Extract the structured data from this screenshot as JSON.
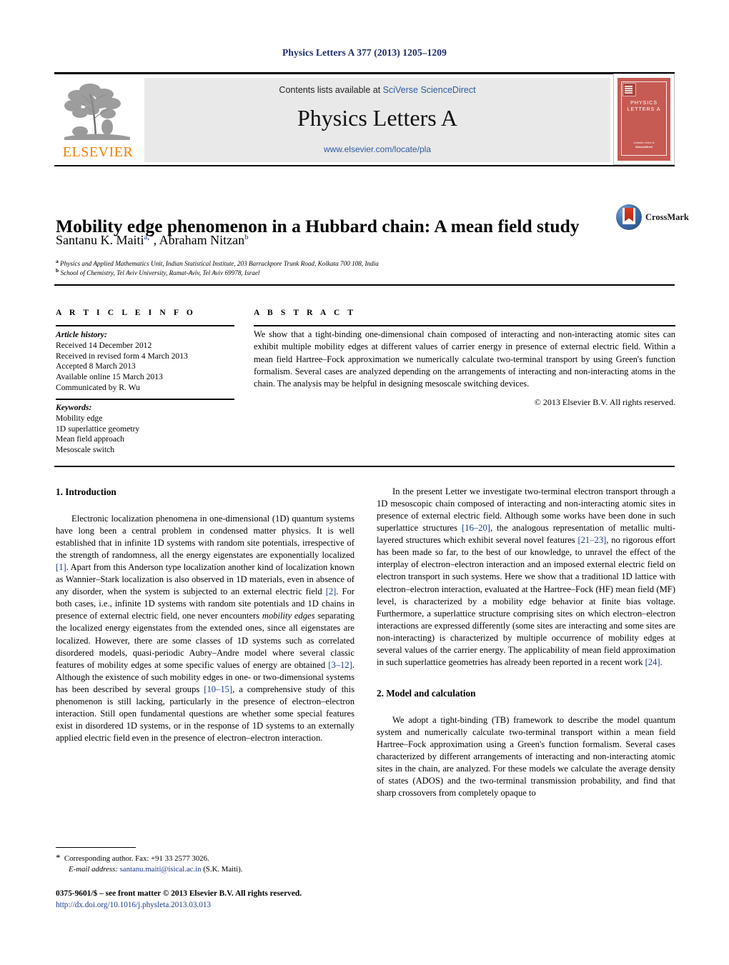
{
  "running_head": "Physics Letters A 377 (2013) 1205–1209",
  "masthead": {
    "contents_prefix": "Contents lists available at ",
    "contents_link": "SciVerse ScienceDirect",
    "journal_title": "Physics Letters A",
    "journal_url": "www.elsevier.com/locate/pla",
    "publisher_name": "ELSEVIER",
    "publisher_color": "#f08000",
    "cover_title": "PHYSICS LETTERS A",
    "cover_color": "#c65b53",
    "cover_footer_line1": "Available online at",
    "cover_footer_line2": "ScienceDirect"
  },
  "article": {
    "title": "Mobility edge phenomenon in a Hubbard chain: A mean field study",
    "authors_part1": "Santanu K. Maiti",
    "authors_sup1": "a",
    "authors_star": ",*",
    "authors_part2": ", Abraham Nitzan",
    "authors_sup2": "b",
    "affiliation_a_sup": "a",
    "affiliation_a": "Physics and Applied Mathematics Unit, Indian Statistical Institute, 203 Barrackpore Trunk Road, Kolkata 700 108, India",
    "affiliation_b_sup": "b",
    "affiliation_b": "School of Chemistry, Tel Aviv University, Ramat-Aviv, Tel Aviv 69978, Israel",
    "crossmark_label": "CrossMark"
  },
  "info": {
    "heading": "A R T I C L E   I N F O",
    "history_label": "Article history:",
    "history": [
      "Received 14 December 2012",
      "Received in revised form 4 March 2013",
      "Accepted 8 March 2013",
      "Available online 15 March 2013",
      "Communicated by R. Wu"
    ],
    "keywords_label": "Keywords:",
    "keywords": [
      "Mobility edge",
      "1D superlattice geometry",
      "Mean field approach",
      "Mesoscale switch"
    ]
  },
  "abstract": {
    "heading": "A B S T R A C T",
    "text": "We show that a tight-binding one-dimensional chain composed of interacting and non-interacting atomic sites can exhibit multiple mobility edges at different values of carrier energy in presence of external electric field. Within a mean field Hartree–Fock approximation we numerically calculate two-terminal transport by using Green's function formalism. Several cases are analyzed depending on the arrangements of interacting and non-interacting atoms in the chain. The analysis may be helpful in designing mesoscale switching devices.",
    "copyright": "© 2013 Elsevier B.V. All rights reserved."
  },
  "sections": {
    "intro_heading": "1. Introduction",
    "model_heading": "2. Model and calculation"
  },
  "body": {
    "left_p1_a": "Electronic localization phenomena in one-dimensional (1D) quantum systems have long been a central problem in condensed matter physics. It is well established that in infinite 1D systems with random site potentials, irrespective of the strength of randomness, all the energy eigenstates are exponentially localized ",
    "left_p1_r1": "[1]",
    "left_p1_b": ". Apart from this Anderson type localization another kind of localization known as Wannier–Stark localization is also observed in 1D materials, even in absence of any disorder, when the system is subjected to an external electric field ",
    "left_p1_r2": "[2]",
    "left_p1_c": ". For both cases, i.e., infinite 1D systems with random site potentials and 1D chains in presence of external electric field, one never encounters ",
    "left_p1_it": "mobility edges",
    "left_p1_d": " separating the localized energy eigenstates from the extended ones, since all eigenstates are localized. However, there are some classes of 1D systems such as correlated disordered models, quasi-periodic Aubry–Andre model where several classic features of mobility edges at some specific values of energy are obtained ",
    "left_p1_r3": "[3–12]",
    "left_p1_e": ". Although the existence of such mobility edges in one- or two-dimensional systems has been described by several groups ",
    "left_p1_r4": "[10–15]",
    "left_p1_f": ", a comprehensive study of this phenomenon is still lacking, particularly in the presence of electron–electron interaction. Still open fundamental questions are whether some special features exist in disordered 1D systems, or in the response of 1D systems to an externally applied electric field even in the presence of electron–electron interaction.",
    "right_p1_a": "In the present Letter we investigate two-terminal electron transport through a 1D mesoscopic chain composed of interacting and non-interacting atomic sites in presence of external electric field. Although some works have been done in such superlattice structures ",
    "right_p1_r1": "[16–20]",
    "right_p1_b": ", the analogous representation of metallic multi-layered structures which exhibit several novel features ",
    "right_p1_r2": "[21–23]",
    "right_p1_c": ", no rigorous effort has been made so far, to the best of our knowledge, to unravel the effect of the interplay of electron–electron interaction and an imposed external electric field on electron transport in such systems. Here we show that a traditional 1D lattice with electron–electron interaction, evaluated at the Hartree–Fock (HF) mean field (MF) level, is characterized by a mobility edge behavior at finite bias voltage. Furthermore, a superlattice structure comprising sites on which electron–electron interactions are expressed differently (some sites are interacting and some sites are non-interacting) is characterized by multiple occurrence of mobility edges at several values of the carrier energy. The applicability of mean field approximation in such superlattice geometries has already been reported in a recent work ",
    "right_p1_r3": "[24]",
    "right_p1_d": ".",
    "right_p2": "We adopt a tight-binding (TB) framework to describe the model quantum system and numerically calculate two-terminal transport within a mean field Hartree–Fock approximation using a Green's function formalism. Several cases characterized by different arrangements of interacting and non-interacting atomic sites in the chain, are analyzed. For these models we calculate the average density of states (ADOS) and the two-terminal transmission probability, and find that sharp crossovers from completely opaque to"
  },
  "footer": {
    "corresponding_star": "*",
    "corresponding": "Corresponding author. Fax: +91 33 2577 3026.",
    "email_label": "E-mail address:",
    "email": "santanu.maiti@isical.ac.in",
    "email_owner": "(S.K. Maiti).",
    "issn_line": "0375-9601/$ – see front matter  © 2013 Elsevier B.V. All rights reserved.",
    "doi": "http://dx.doi.org/10.1016/j.physleta.2013.03.013"
  }
}
